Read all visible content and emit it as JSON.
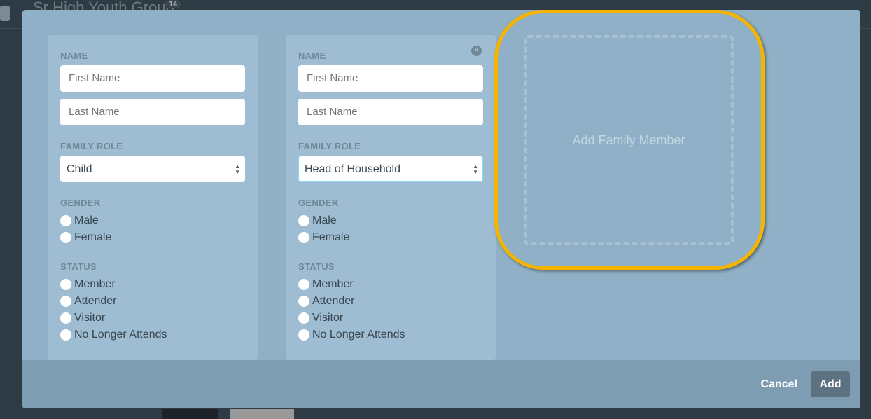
{
  "background": {
    "title": "Sr High Youth Group",
    "badge": "14"
  },
  "labels": {
    "name": "NAME",
    "family_role": "FAMILY ROLE",
    "gender": "GENDER",
    "status": "STATUS"
  },
  "placeholders": {
    "first": "First Name",
    "last": "Last Name"
  },
  "members": [
    {
      "role": "Child",
      "gender": [
        "Male",
        "Female"
      ],
      "status": [
        "Member",
        "Attender",
        "Visitor",
        "No Longer Attends"
      ]
    },
    {
      "role": "Head of Household",
      "gender": [
        "Male",
        "Female"
      ],
      "status": [
        "Member",
        "Attender",
        "Visitor",
        "No Longer Attends"
      ]
    }
  ],
  "remove_icon": "×",
  "add_member": "Add Family Member",
  "footer": {
    "cancel": "Cancel",
    "add": "Add"
  },
  "colors": {
    "highlight": "#f5b400",
    "modal": "#8fb0c6",
    "card": "#9ebdd3"
  }
}
